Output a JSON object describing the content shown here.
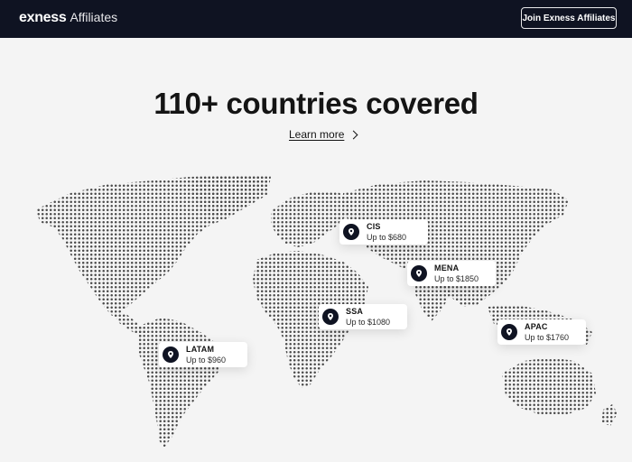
{
  "header": {
    "logo_word": "exness",
    "logo_sub": "Affiliates",
    "join_label": "Join Exness Affiliates"
  },
  "hero": {
    "title": "110+ countries covered",
    "learn_more": "Learn more"
  },
  "regions": [
    {
      "name": "CIS",
      "amount": "Up to $680"
    },
    {
      "name": "MENA",
      "amount": "Up to $1850"
    },
    {
      "name": "SSA",
      "amount": "Up to $1080"
    },
    {
      "name": "APAC",
      "amount": "Up to $1760"
    },
    {
      "name": "LATAM",
      "amount": "Up to $960"
    }
  ],
  "colors": {
    "navbar": "#0f1322",
    "background": "#f4f4f4",
    "map_dot": "#4a4a4a"
  },
  "icons": [
    "location-pin-icon",
    "chevron-right-icon"
  ]
}
